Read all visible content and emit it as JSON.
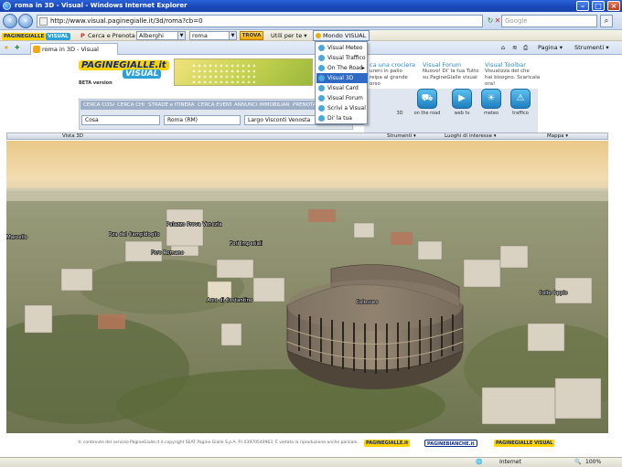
{
  "window": {
    "title": "roma in 3D - Visual - Windows Internet Explorer"
  },
  "address": {
    "url": "http://www.visual.paginegialle.it/3d/roma?cb=0",
    "search_placeholder": "Google"
  },
  "toolbar": {
    "pg_logo": "PAGINEGIALLE",
    "visual_logo": "VISUAL",
    "cerca_prenota": "Cerca e Prenota",
    "category_value": "Alberghi",
    "city_value": "roma",
    "trova_label": "TROVA",
    "utili_label": "Utili per te",
    "mondo_label": "Mondo VISUAL"
  },
  "tabs": {
    "active_tab": "roma in 3D - Visual",
    "pagina": "Pagina",
    "strumenti": "Strumenti"
  },
  "menu": {
    "items": [
      "Visual Meteo",
      "Visual Traffico",
      "On The Road",
      "Visual 3D",
      "Visual Card",
      "Visual Forum",
      "Scrivi a Visual",
      "Di' la tua"
    ],
    "selected": "Visual 3D"
  },
  "header": {
    "logo_pg": "PAGINEGIALLE.it",
    "logo_visual": "VISUAL",
    "beta": "BETA version"
  },
  "promos": [
    {
      "title": "ca una crociera",
      "body": "ureni in palio\nreipa al grande\norso"
    },
    {
      "title": "Visual Forum",
      "body": "Nuovo! Di' la tua Tutto\nsu PagineGialle visual"
    },
    {
      "title": "Visual Toolbar",
      "body": "Visualizza del che\nhai bisogno. Scaricala ora!"
    }
  ],
  "search": {
    "tabs": [
      "CERCA COSA",
      "CERCA CHI",
      "STRADE e ITINERARI",
      "CERCA EVENTI",
      "ANNUNCI IMMOBILIARI",
      "PRENOTA"
    ],
    "cosa_value": "Cosa",
    "dove_value": "Roma (RM)",
    "indirizzo_value": "Largo Visconti Venosta"
  },
  "visual_icons": {
    "label_3d": "3D",
    "items": [
      "on the road",
      "web tv",
      "meteo",
      "traffico"
    ]
  },
  "viewbar": {
    "title": "Vista 3D",
    "strumenti": "Strumenti",
    "luoghi": "Luoghi di interesse",
    "mappa": "Mappa"
  },
  "map_labels": {
    "palazzo": "Palazzo Prova Venezia",
    "campidoglio": "Pza del Campidoglio",
    "foro_romano": "Foro Romano",
    "fori_imperiali": "Fori Imperiali",
    "marcello": "Marcello",
    "colosseo": "Colosseo",
    "arco": "Arco di Costantino",
    "colle_oppio": "Colle Oppio"
  },
  "footer": {
    "copyright": "© contenuto del servizio PagineGialle.it è copyright SEAT Pagine Gialle S.p.A. P.I.03970540963. È vietata la riproduzione anche parziale.",
    "logos": [
      "PAGINEGIALLE.it",
      "PAGINEBIANCHE.it",
      "PAGINEGIALLE VISUAL"
    ]
  },
  "status": {
    "zone": "Internet",
    "zoom": "100%"
  },
  "colors": {
    "title_blue": "#1947b8",
    "pg_yellow": "#ffd200",
    "visual_blue": "#2aa2d8",
    "menu_highlight": "#316ac5"
  }
}
